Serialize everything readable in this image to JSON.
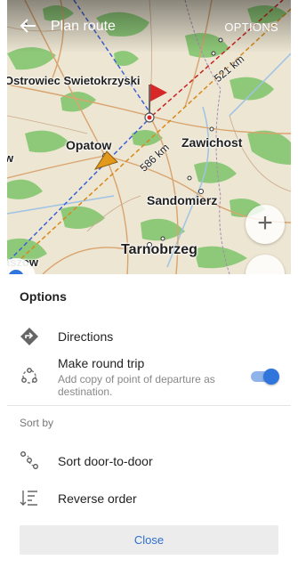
{
  "header": {
    "title": "Plan route",
    "options_label": "OPTIONS"
  },
  "map": {
    "labels": {
      "ostrowiec": "Ostrowiec Swietokrzyski",
      "opatow": "Opatow",
      "zawichost": "Zawichost",
      "sandomierz": "Sandomierz",
      "tarnobrzeg": "Tarnobrzeg",
      "partial_w": "w",
      "partial_aszow": "aszow"
    },
    "distances": {
      "upper": "521 km",
      "lower": "586 km"
    },
    "zoom_in_label": "+"
  },
  "sheet": {
    "title": "Options",
    "directions_label": "Directions",
    "round_trip_label": "Make round trip",
    "round_trip_desc": "Add copy of point of departure as destination.",
    "round_trip_enabled": true,
    "sort_section": "Sort by",
    "door_to_door_label": "Sort door-to-door",
    "reverse_label": "Reverse order",
    "close_label": "Close"
  },
  "colors": {
    "accent": "#2f75dc",
    "route_blue": "#3c5fd6",
    "route_orange": "#d8891a",
    "route_red": "#cc2222",
    "flag_red": "#d62828",
    "marker_orange": "#e39a1c"
  }
}
